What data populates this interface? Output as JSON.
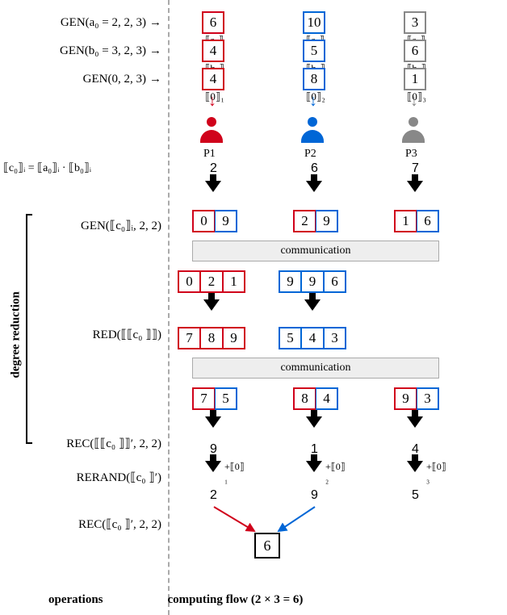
{
  "ops": {
    "gen_a": "GEN(a₀ = 2, 2, 3)",
    "gen_b": "GEN(b₀ = 3, 2, 3)",
    "gen_0": "GEN(0, 2, 3)",
    "c_eq": "⟦c₀⟧ᵢ = ⟦a₀⟧ᵢ · ⟦b₀⟧ᵢ",
    "gen_c": "GEN(⟦c₀⟧ᵢ, 2, 2)",
    "red": "RED(⟦⟦c₀ ⟧⟧)",
    "rec1": "REC(⟦⟦c₀ ⟧⟧′, 2, 2)",
    "rerand": "RERAND(⟦c₀ ⟧′)",
    "rec2": "REC(⟦c₀ ⟧′, 2, 2)",
    "degree_reduction": "degree reduction",
    "operations": "operations",
    "computing_flow": "computing flow (2 × 3 = 6)"
  },
  "row1": {
    "v1": "6",
    "l1": "⟦a₀⟧₁",
    "v2": "10",
    "l2": "⟦a₀⟧₂",
    "v3": "3",
    "l3": "⟦a₀⟧₃"
  },
  "row2": {
    "v1": "4",
    "l1": "⟦b₀⟧₁",
    "v2": "5",
    "l2": "⟦b₀⟧₂",
    "v3": "6",
    "l3": "⟦b₀⟧₃"
  },
  "row3": {
    "v1": "4",
    "l1": "⟦0⟧₁",
    "v2": "8",
    "l2": "⟦0⟧₂",
    "v3": "1",
    "l3": "⟦0⟧₃"
  },
  "people": {
    "p1": "P1",
    "p2": "P2",
    "p3": "P3"
  },
  "mult": {
    "v1": "2",
    "v2": "6",
    "v3": "7"
  },
  "genc": {
    "p1a": "0",
    "p1b": "9",
    "p2a": "2",
    "p2b": "9",
    "p3a": "1",
    "p3b": "6"
  },
  "comm": "communication",
  "redc_in": {
    "g1a": "0",
    "g1b": "2",
    "g1c": "1",
    "g2a": "9",
    "g2b": "9",
    "g2c": "6"
  },
  "redc_out": {
    "g1a": "7",
    "g1b": "8",
    "g1c": "9",
    "g2a": "5",
    "g2b": "4",
    "g2c": "3"
  },
  "rec_in": {
    "p1a": "7",
    "p1b": "5",
    "p2a": "8",
    "p2b": "4",
    "p3a": "9",
    "p3b": "3"
  },
  "rec_out": {
    "v1": "9",
    "v2": "1",
    "v3": "4"
  },
  "rerand_add": {
    "a1": "+⟦0⟧₁",
    "a2": "+⟦0⟧₂",
    "a3": "+⟦0⟧₃"
  },
  "rerand_out": {
    "v1": "2",
    "v2": "9",
    "v3": "5"
  },
  "final": "6"
}
